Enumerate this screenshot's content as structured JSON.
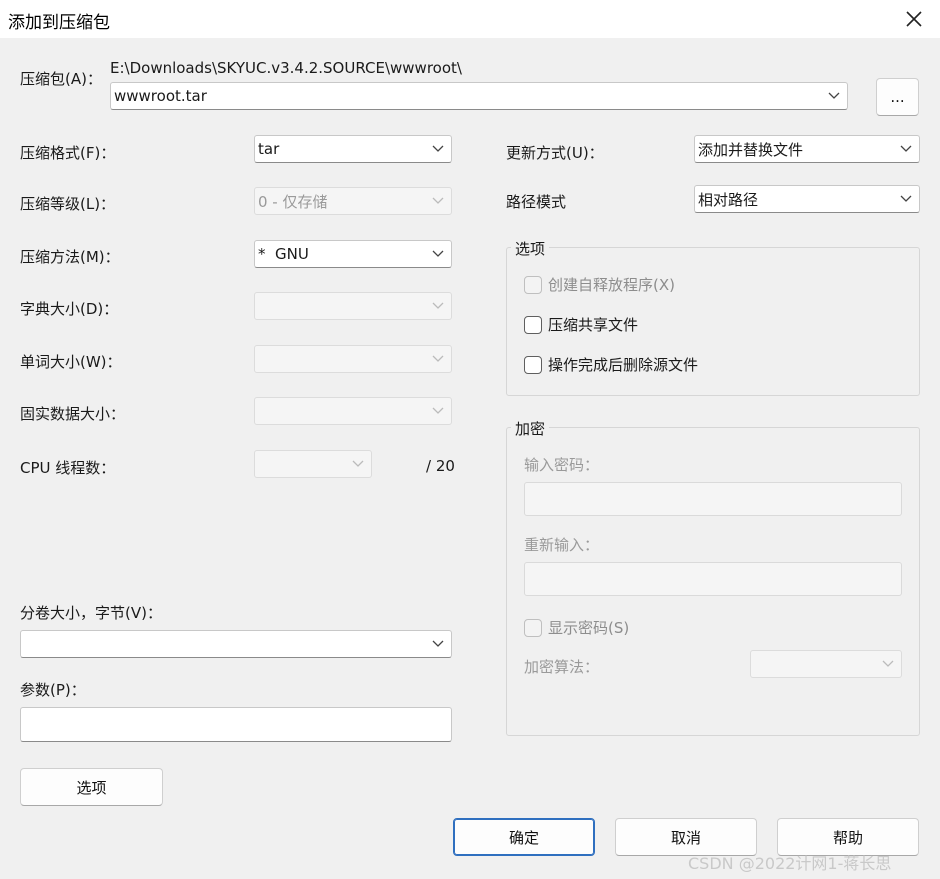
{
  "window": {
    "title": "添加到压缩包",
    "close_icon": "close-icon"
  },
  "archive": {
    "label": "压缩包(A)：",
    "path": "E:\\Downloads\\SKYUC.v3.4.2.SOURCE\\wwwroot\\",
    "name": "wwwroot.tar",
    "browse_label": "..."
  },
  "left": {
    "format": {
      "label": "压缩格式(F)：",
      "value": "tar"
    },
    "level": {
      "label": "压缩等级(L)：",
      "value": "0 - 仅存储"
    },
    "method": {
      "label": "压缩方法(M)：",
      "value": "*  GNU"
    },
    "dict": {
      "label": "字典大小(D)：",
      "value": ""
    },
    "word": {
      "label": "单词大小(W)：",
      "value": ""
    },
    "solid": {
      "label": "固实数据大小：",
      "value": ""
    },
    "cpu": {
      "label": "CPU 线程数：",
      "value": "",
      "max": "/ 20"
    },
    "volume": {
      "label": "分卷大小，字节(V)：",
      "value": ""
    },
    "params": {
      "label": "参数(P)：",
      "value": ""
    },
    "options_button": "选项"
  },
  "right": {
    "update": {
      "label": "更新方式(U)：",
      "value": "添加并替换文件"
    },
    "pathmode": {
      "label": "路径模式",
      "value": "相对路径"
    },
    "options_group": {
      "title": "选项",
      "sfx": {
        "label": "创建自释放程序(X)",
        "checked": false,
        "enabled": false
      },
      "shared": {
        "label": "压缩共享文件",
        "checked": false,
        "enabled": true
      },
      "delete": {
        "label": "操作完成后删除源文件",
        "checked": false,
        "enabled": true
      }
    },
    "encryption": {
      "title": "加密",
      "password_label": "输入密码：",
      "reenter_label": "重新输入：",
      "show_password": {
        "label": "显示密码(S)",
        "checked": false,
        "enabled": false
      },
      "method_label": "加密算法："
    }
  },
  "buttons": {
    "ok": "确定",
    "cancel": "取消",
    "help": "帮助"
  },
  "watermark": "CSDN @2022计网1-蒋长思"
}
